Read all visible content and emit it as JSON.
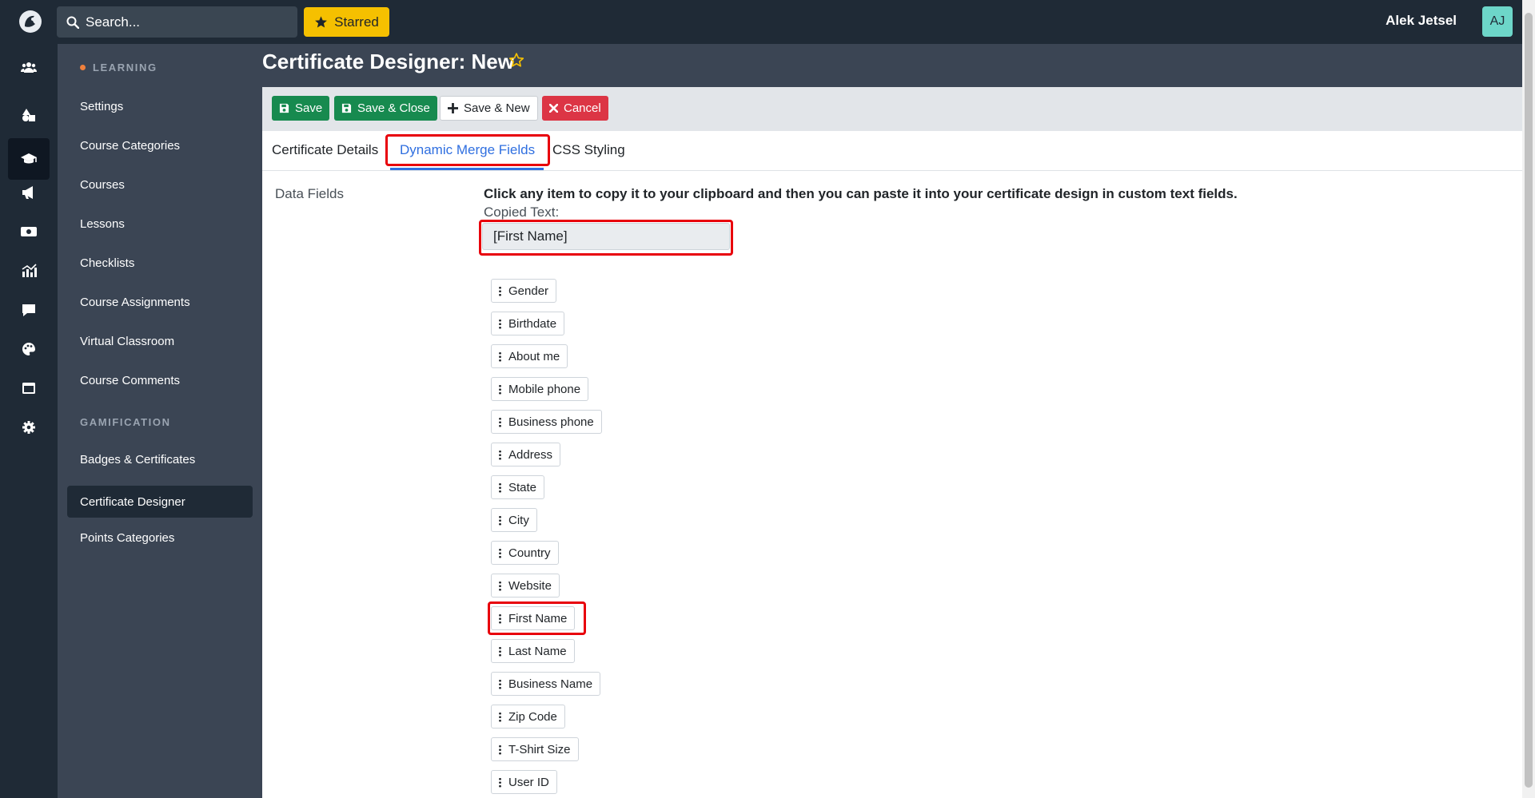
{
  "topbar": {
    "search_placeholder": "Search...",
    "starred_label": "Starred",
    "user_name": "Alek Jetsel",
    "avatar_initials": "AJ"
  },
  "rail": {
    "icons": [
      "users-icon",
      "shapes-icon",
      "graduation-cap-icon",
      "megaphone-icon",
      "money-icon",
      "chart-icon",
      "comment-icon",
      "palette-icon",
      "window-icon",
      "gear-icon"
    ],
    "active_index": 2
  },
  "sidebar": {
    "section1": "LEARNING",
    "section1_items": [
      "Settings",
      "Course Categories",
      "Courses",
      "Lessons",
      "Checklists",
      "Course Assignments",
      "Virtual Classroom",
      "Course Comments"
    ],
    "section2": "GAMIFICATION",
    "section2_items": [
      "Badges & Certificates",
      "Certificate Designer",
      "Points Categories"
    ],
    "active_item": "Certificate Designer"
  },
  "page": {
    "title": "Certificate Designer: New"
  },
  "toolbar": {
    "save_label": "Save",
    "save_close_label": "Save & Close",
    "save_new_label": "Save & New",
    "cancel_label": "Cancel"
  },
  "tabs": {
    "items": [
      "Certificate Details",
      "Dynamic Merge Fields",
      "CSS Styling"
    ],
    "active": "Dynamic Merge Fields"
  },
  "content": {
    "field_label": "Data Fields",
    "instruction": "Click any item to copy it to your clipboard and then you can paste it into your certificate design in custom text fields.",
    "copied_label": "Copied Text:",
    "copied_value": "[First Name]",
    "merge_fields": [
      "Gender",
      "Birthdate",
      "About me",
      "Mobile phone",
      "Business phone",
      "Address",
      "State",
      "City",
      "Country",
      "Website",
      "First Name",
      "Last Name",
      "Business Name",
      "Zip Code",
      "T-Shirt Size",
      "User ID"
    ],
    "highlighted_field": "First Name"
  },
  "colors": {
    "dark_nav": "#1f2a36",
    "sidebar": "#3b4554",
    "accent_blue": "#2f6fe0",
    "save_green": "#178a4f",
    "cancel_red": "#dc3545",
    "starred_yellow": "#f5c000",
    "highlight_red": "#e8000b"
  }
}
